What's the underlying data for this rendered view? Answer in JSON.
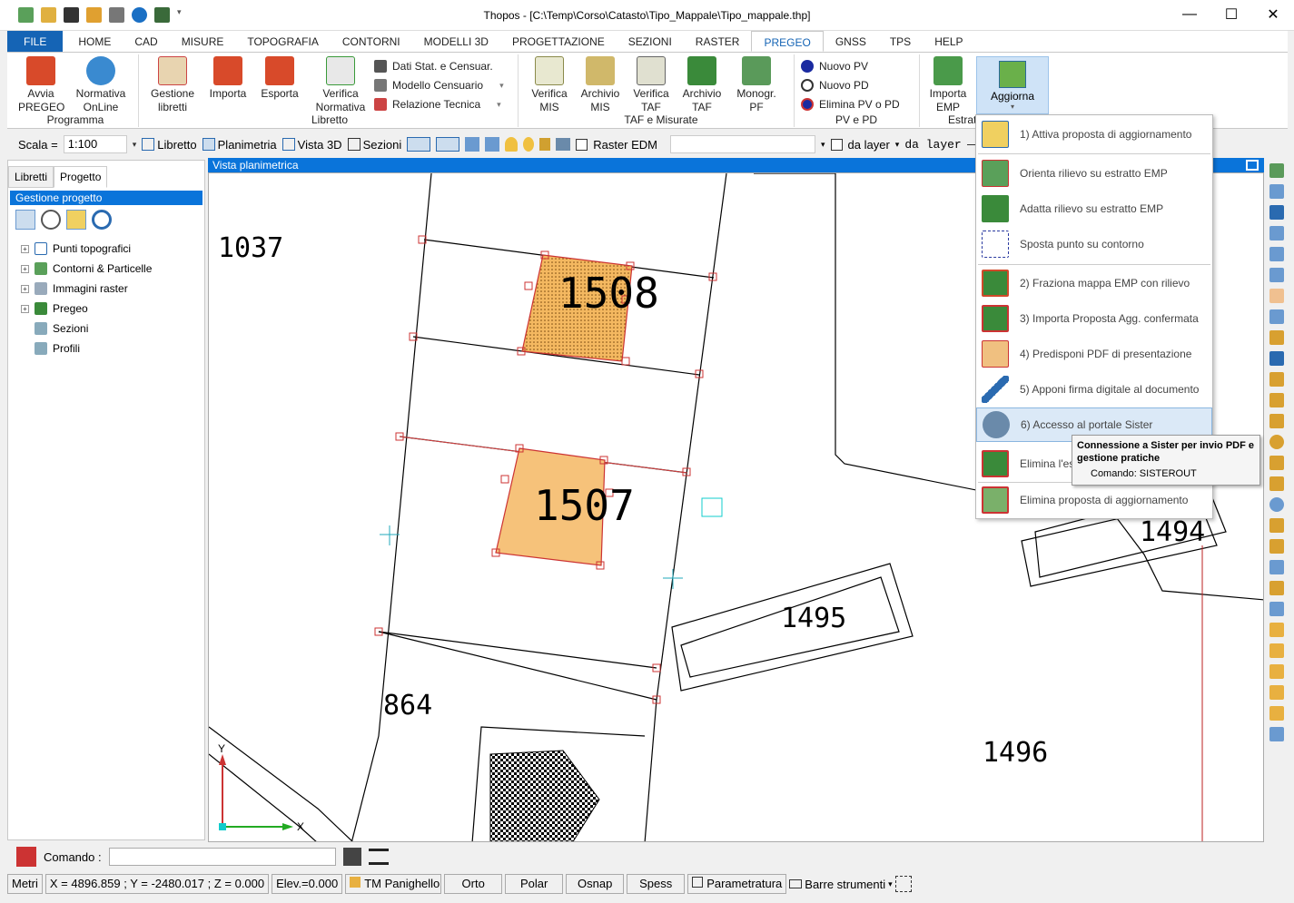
{
  "window": {
    "title": "Thopos - [C:\\Temp\\Corso\\Catasto\\Tipo_Mappale\\Tipo_mappale.thp]",
    "minimize": "—",
    "maximize": "☐",
    "close": "✕"
  },
  "menu": {
    "file": "FILE",
    "tabs": [
      "HOME",
      "CAD",
      "MISURE",
      "TOPOGRAFIA",
      "CONTORNI",
      "MODELLI 3D",
      "PROGETTAZIONE",
      "SEZIONI",
      "RASTER",
      "PREGEO",
      "GNSS",
      "TPS",
      "HELP"
    ],
    "active": "PREGEO"
  },
  "ribbon": {
    "programma": {
      "label": "Programma",
      "avvia_1": "Avvia",
      "avvia_2": "PREGEO",
      "norm_1": "Normativa",
      "norm_2": "OnLine"
    },
    "libretto": {
      "label": "Libretto",
      "gest_1": "Gestione",
      "gest_2": "libretti",
      "importa": "Importa",
      "esporta": "Esporta",
      "verif_1": "Verifica",
      "verif_2": "Normativa",
      "dati": "Dati Stat. e Censuar.",
      "modello": "Modello Censuario",
      "relazione": "Relazione Tecnica"
    },
    "taf": {
      "label": "TAF e Misurate",
      "vmis_1": "Verifica",
      "vmis_2": "MIS",
      "amis_1": "Archivio",
      "amis_2": "MIS",
      "vtaf_1": "Verifica",
      "vtaf_2": "TAF",
      "ataf_1": "Archivio",
      "ataf_2": "TAF",
      "mono_1": "Monogr.",
      "mono_2": "PF"
    },
    "pvpd": {
      "label": "PV e PD",
      "nuovo_pv": "Nuovo PV",
      "nuovo_pd": "Nuovo PD",
      "elimina": "Elimina PV o PD"
    },
    "estratto": {
      "label": "Estrat",
      "imp_1": "Importa",
      "imp_2": "EMP",
      "agg": "Aggiorna"
    }
  },
  "toolbar": {
    "scala_label": "Scala =",
    "scala_value": "1:100",
    "libretto": "Libretto",
    "planimetria": "Planimetria",
    "vista3d": "Vista 3D",
    "sezioni": "Sezioni",
    "raster": "Raster EDM",
    "da_layer": "da layer",
    "da_layer2": "da layer"
  },
  "leftpanel": {
    "tabs": [
      "Libretti",
      "Progetto"
    ],
    "header": "Gestione progetto",
    "tree": [
      "Punti topografici",
      "Contorni & Particelle",
      "Immagini raster",
      "Pregeo",
      "Sezioni",
      "Profili"
    ]
  },
  "canvas": {
    "title": "Vista planimetrica",
    "parcels": [
      "1037",
      "1508",
      "1507",
      "864",
      "1495",
      "1494",
      "1496"
    ],
    "axis_x": "X",
    "axis_y": "Y"
  },
  "dropdown": {
    "items": [
      "1) Attiva proposta di aggiornamento",
      "Orienta rilievo su estratto EMP",
      "Adatta rilievo su estratto EMP",
      "Sposta punto su contorno",
      "2) Fraziona mappa EMP con rilievo",
      "3) Importa Proposta Agg. confermata",
      "4) Predisponi PDF di presentazione",
      "5) Apponi firma digitale al documento",
      "6) Accesso al portale Sister",
      "Elimina l'es",
      "Elimina proposta di aggiornamento"
    ]
  },
  "tooltip": {
    "title": "Connessione a Sister per invio PDF e gestione pratiche",
    "command": "Comando: SISTEROUT"
  },
  "command": {
    "label": "Comando :"
  },
  "status": {
    "units": "Metri",
    "coords": "X = 4896.859 ; Y = -2480.017 ; Z = 0.000",
    "elev": "Elev.=0.000",
    "tm": "TM Panighello",
    "orto": "Orto",
    "polar": "Polar",
    "osnap": "Osnap",
    "spess": "Spess",
    "param": "Parametratura",
    "barre": "Barre strumenti"
  }
}
